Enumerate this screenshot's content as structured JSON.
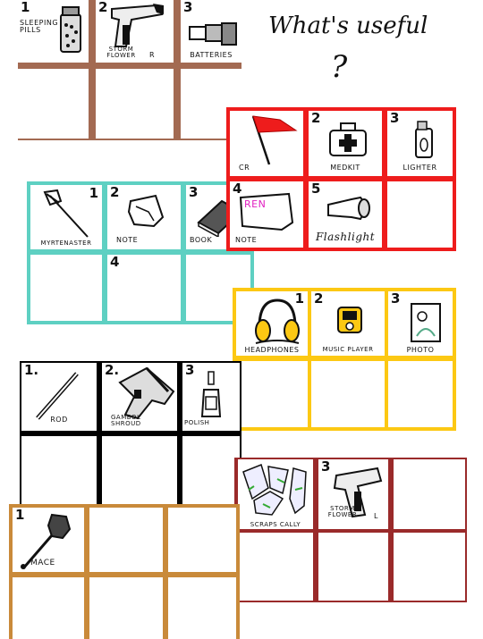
{
  "title": "What's useful",
  "question_mark": "?",
  "grids": {
    "brown": {
      "cells": [
        {
          "num": "1",
          "label": "SLEEPING PILLS"
        },
        {
          "num": "2",
          "label": "STORM FLOWER",
          "extra": "R"
        },
        {
          "num": "3",
          "label": "BATTERIES"
        }
      ]
    },
    "red": {
      "cells": [
        {
          "num": "",
          "label": "CR"
        },
        {
          "num": "2",
          "label": "MEDKIT"
        },
        {
          "num": "3",
          "label": "LIGHTER"
        },
        {
          "num": "4",
          "label": "NOTE",
          "note_text": "REN"
        },
        {
          "num": "5",
          "label": "Flashlight"
        }
      ]
    },
    "teal": {
      "cells": [
        {
          "num": "1",
          "label": "MYRTENASTER"
        },
        {
          "num": "2",
          "label": "NOTE"
        },
        {
          "num": "3",
          "label": "BOOK"
        },
        {
          "num": "4",
          "label": ""
        }
      ]
    },
    "yellow": {
      "cells": [
        {
          "num": "1",
          "label": "HEADPHONES"
        },
        {
          "num": "2",
          "label": "MUSIC PLAYER"
        },
        {
          "num": "3",
          "label": "PHOTO"
        }
      ]
    },
    "black": {
      "cells": [
        {
          "num": "1.",
          "label": "ROD"
        },
        {
          "num": "2.",
          "label": "GAMBOL SHROUD"
        },
        {
          "num": "3",
          "label": "POLISH"
        }
      ]
    },
    "darkred": {
      "cells": [
        {
          "num": "",
          "label": "SCRAPS CALLY"
        },
        {
          "num": "3",
          "label": "STORM FLOWER",
          "extra": "L"
        }
      ]
    },
    "orange": {
      "cells": [
        {
          "num": "1",
          "label": "MACE"
        }
      ]
    }
  },
  "colors": {
    "brown": "#a36a52",
    "red": "#ee1c1c",
    "teal": "#5ed0c2",
    "yellow": "#fcc813",
    "black": "#000000",
    "darkred": "#9a2a2a",
    "orange": "#c98a3a"
  }
}
